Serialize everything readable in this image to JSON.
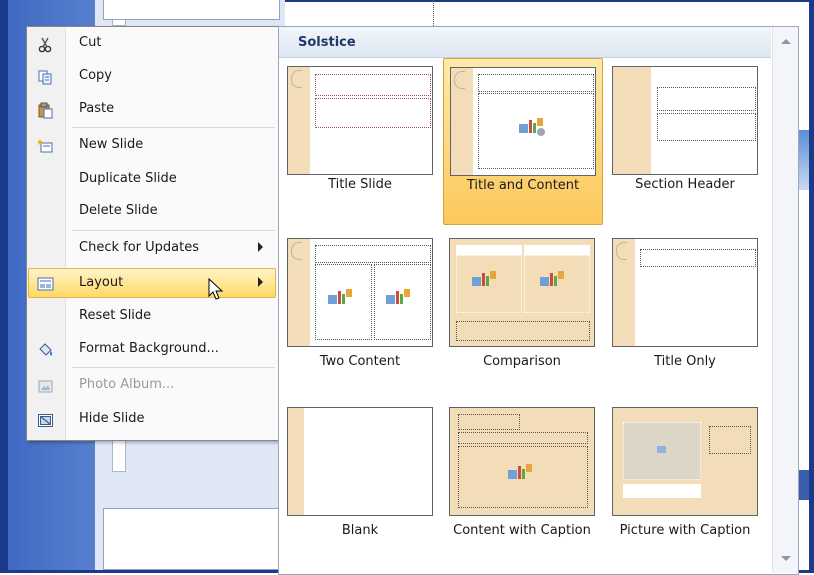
{
  "context_menu": {
    "items": [
      {
        "label": "Cut",
        "icon": "scissors-icon",
        "disabled": false
      },
      {
        "label": "Copy",
        "icon": "copy-icon",
        "disabled": false
      },
      {
        "label": "Paste",
        "icon": "paste-icon",
        "disabled": false
      },
      {
        "label": "New Slide",
        "icon": "new-slide-icon",
        "disabled": false
      },
      {
        "label": "Duplicate Slide",
        "icon": "",
        "disabled": false
      },
      {
        "label": "Delete Slide",
        "icon": "",
        "disabled": false
      },
      {
        "label": "Check for Updates",
        "icon": "",
        "disabled": false,
        "submenu": true
      },
      {
        "label": "Layout",
        "icon": "layout-icon",
        "disabled": false,
        "submenu": true,
        "highlighted": true
      },
      {
        "label": "Reset Slide",
        "icon": "",
        "disabled": false
      },
      {
        "label": "Format Background...",
        "icon": "paint-bucket-icon",
        "disabled": false
      },
      {
        "label": "Photo Album...",
        "icon": "photo-album-icon",
        "disabled": true
      },
      {
        "label": "Hide Slide",
        "icon": "hide-slide-icon",
        "disabled": false
      }
    ]
  },
  "layout_gallery": {
    "header": "Solstice",
    "selected": "Title and Content",
    "layouts": [
      {
        "label": "Title Slide"
      },
      {
        "label": "Title and Content"
      },
      {
        "label": "Section Header"
      },
      {
        "label": "Two Content"
      },
      {
        "label": "Comparison"
      },
      {
        "label": "Title Only"
      },
      {
        "label": "Blank"
      },
      {
        "label": "Content with Caption"
      },
      {
        "label": "Picture with Caption"
      }
    ]
  },
  "colors": {
    "theme_tan": "#f2ddb8",
    "highlight_gold": "#fcc85a",
    "window_blue": "#1c3a8a"
  }
}
